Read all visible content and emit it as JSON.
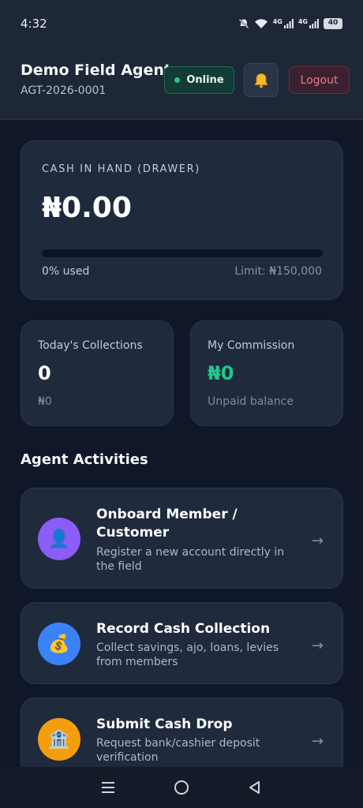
{
  "status_bar": {
    "time": "4:32",
    "battery": "40",
    "signal_1": "4G",
    "signal_2": "4G"
  },
  "header": {
    "agent_name": "Demo Field Agent",
    "agent_code": "AGT-2026-0001",
    "status_label": "Online",
    "logout_label": "Logout",
    "bell_icon": "bell-icon"
  },
  "cash_card": {
    "label": "CASH IN HAND (DRAWER)",
    "amount": "₦0.00",
    "progress_percent": 0,
    "used_text": "0% used",
    "limit_text": "Limit: ₦150,000"
  },
  "stats": {
    "collections": {
      "title": "Today's Collections",
      "value": "0",
      "sub": "₦0"
    },
    "commission": {
      "title": "My Commission",
      "value": "₦0",
      "sub": "Unpaid balance"
    }
  },
  "activities": {
    "title": "Agent Activities",
    "items": [
      {
        "title": "Onboard Member / Customer",
        "desc": "Register a new account directly in the field",
        "icon": "👤",
        "icon_name": "user-icon",
        "color": "#8b5cf6"
      },
      {
        "title": "Record Cash Collection",
        "desc": "Collect savings, ajo, loans, levies from members",
        "icon": "💰",
        "icon_name": "money-bag-icon",
        "color": "#3b82f6"
      },
      {
        "title": "Submit Cash Drop",
        "desc": "Request bank/cashier deposit verification",
        "icon": "🏦",
        "icon_name": "bank-icon",
        "color": "#f59e0b"
      }
    ],
    "arrow": "→"
  },
  "colors": {
    "background": "#0f1729",
    "card": "#1f2a3c",
    "accent_green": "#22c58b",
    "logout_red": "#f07a84"
  }
}
